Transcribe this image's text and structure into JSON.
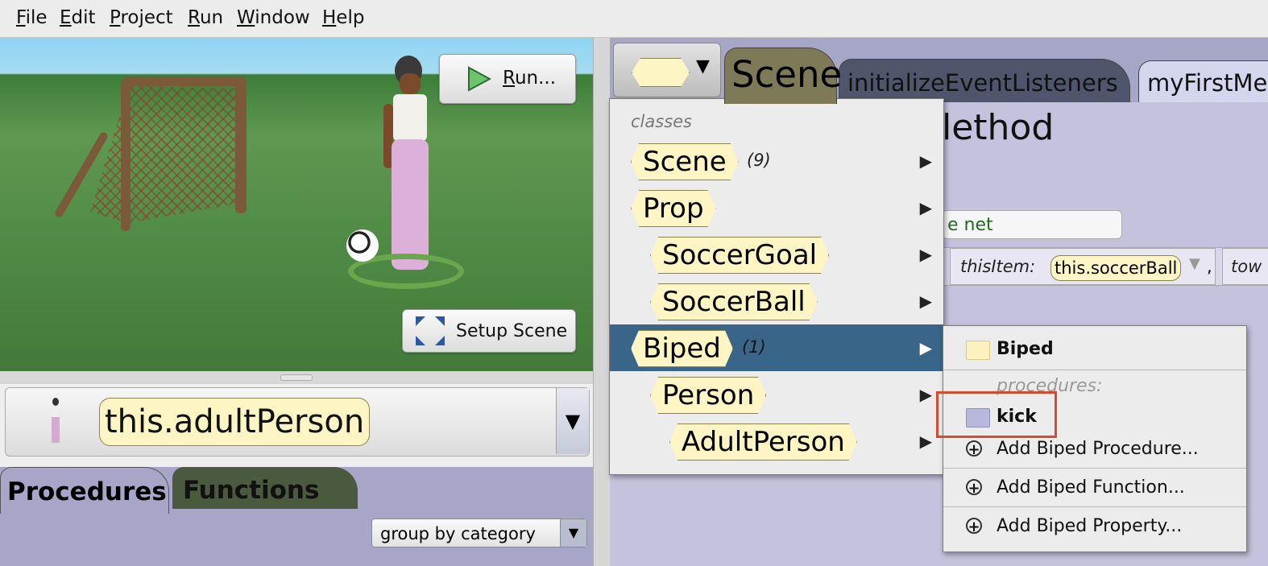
{
  "menubar": {
    "items": [
      {
        "mnemonic": "F",
        "rest": "ile"
      },
      {
        "mnemonic": "E",
        "rest": "dit"
      },
      {
        "mnemonic": "P",
        "rest": "roject"
      },
      {
        "mnemonic": "R",
        "rest": "un"
      },
      {
        "mnemonic": "W",
        "rest": "indow"
      },
      {
        "mnemonic": "H",
        "rest": "elp"
      }
    ]
  },
  "scene_view": {
    "run_button": {
      "mnemonic": "R",
      "rest": "un..."
    },
    "setup_scene_label": "Setup Scene"
  },
  "selector": {
    "instance": "this.adultPerson",
    "dropdown_glyph": "▼"
  },
  "bottom_tabs": {
    "procedures": "Procedures",
    "functions": "Functions",
    "group_by": "group by category",
    "group_arrow": "▼"
  },
  "editor": {
    "class_button_arrow": "▼",
    "tabs": {
      "scene": "Scene",
      "init": "initializeEventListeners",
      "myfirst": "myFirstMet"
    },
    "method_title": "lethod",
    "code_line1": "e net",
    "code_line2": {
      "param_label": "thisItem:",
      "param_value": "this.soccerBall",
      "comma": ",",
      "next_param": "tow"
    }
  },
  "class_menu": {
    "section_label": "classes",
    "items": [
      {
        "name": "Scene",
        "count": "(9)"
      },
      {
        "name": "Prop",
        "count": ""
      },
      {
        "name": "SoccerGoal",
        "count": ""
      },
      {
        "name": "SoccerBall",
        "count": ""
      },
      {
        "name": "Biped",
        "count": "(1)"
      },
      {
        "name": "Person",
        "count": ""
      },
      {
        "name": "AdultPerson",
        "count": ""
      }
    ],
    "arrow_glyph": "▶"
  },
  "sub_menu": {
    "class_name": "Biped",
    "procedures_label": "procedures:",
    "procedure": "kick",
    "add_procedure": "Add Biped Procedure...",
    "add_function": "Add Biped Function...",
    "add_property": "Add Biped Property..."
  },
  "colors": {
    "tile_fill": "#fdf5c4",
    "menu_selected": "#396588",
    "highlight_box": "#d84a2c",
    "procedures_tab": "#a7a6c9",
    "functions_tab": "#4a5a3e"
  }
}
